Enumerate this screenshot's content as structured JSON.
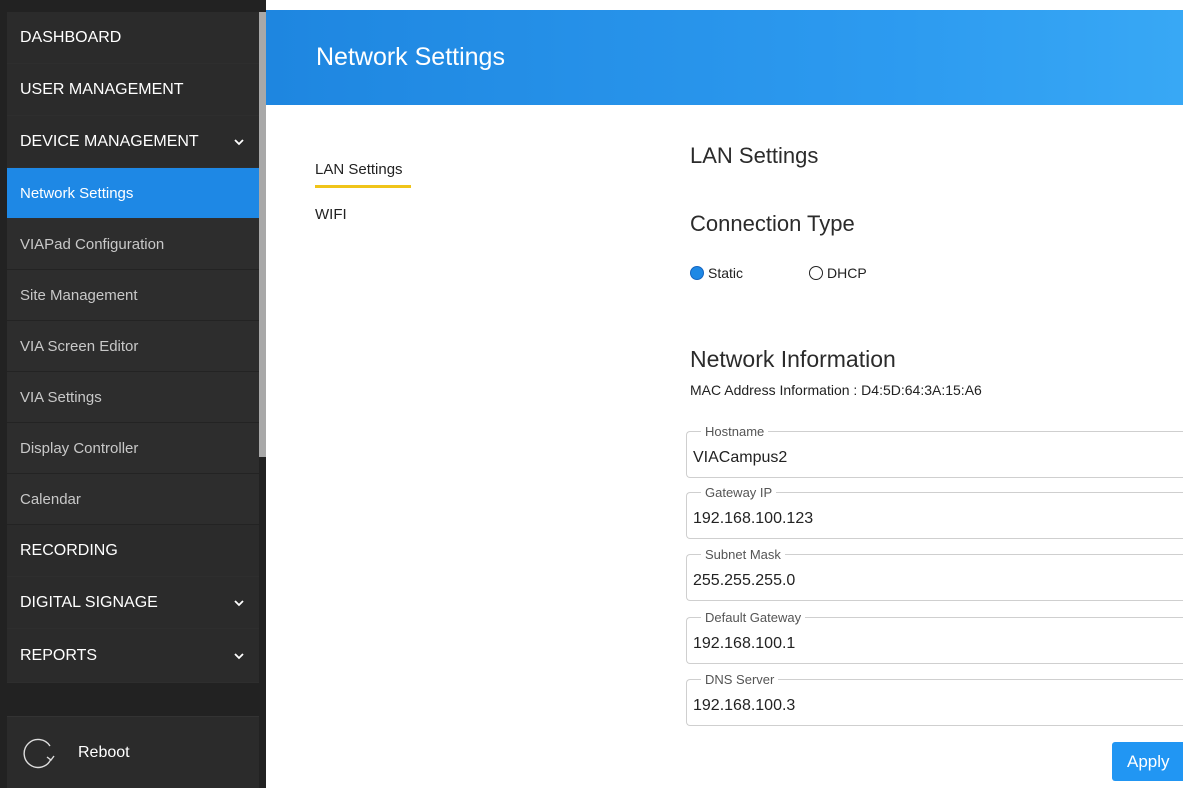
{
  "sidebar": {
    "items": [
      {
        "label": "DASHBOARD"
      },
      {
        "label": "USER MANAGEMENT"
      },
      {
        "label": "DEVICE MANAGEMENT",
        "expandable": true
      },
      {
        "label": "Network Settings",
        "active": true
      },
      {
        "label": "VIAPad Configuration"
      },
      {
        "label": "Site Management"
      },
      {
        "label": "VIA Screen Editor"
      },
      {
        "label": "VIA Settings"
      },
      {
        "label": "Display Controller"
      },
      {
        "label": "Calendar"
      },
      {
        "label": "RECORDING"
      },
      {
        "label": "DIGITAL SIGNAGE",
        "expandable": true
      },
      {
        "label": "REPORTS",
        "expandable": true
      }
    ],
    "reboot_label": "Reboot",
    "reboot_icon": "refresh-icon"
  },
  "header": {
    "title": "Network Settings"
  },
  "tabs": [
    {
      "label": "LAN Settings",
      "active": true
    },
    {
      "label": "WIFI"
    }
  ],
  "main": {
    "lan_title": "LAN Settings",
    "connection_title": "Connection Type",
    "connection_options": [
      {
        "label": "Static",
        "selected": true
      },
      {
        "label": "DHCP",
        "selected": false
      }
    ],
    "network_title": "Network Information",
    "mac_line": "MAC Address Information : D4:5D:64:3A:15:A6",
    "fields": [
      {
        "label": "Hostname",
        "value": "VIACampus2"
      },
      {
        "label": "Gateway IP",
        "value": "192.168.100.123"
      },
      {
        "label": "Subnet Mask",
        "value": "255.255.255.0"
      },
      {
        "label": "Default Gateway",
        "value": "192.168.100.1"
      },
      {
        "label": "DNS Server",
        "value": "192.168.100.3"
      }
    ],
    "apply_label": "Apply"
  },
  "colors": {
    "accent": "#1e88e5",
    "sidebar_bg": "#222222",
    "tab_underline": "#f0c419"
  }
}
